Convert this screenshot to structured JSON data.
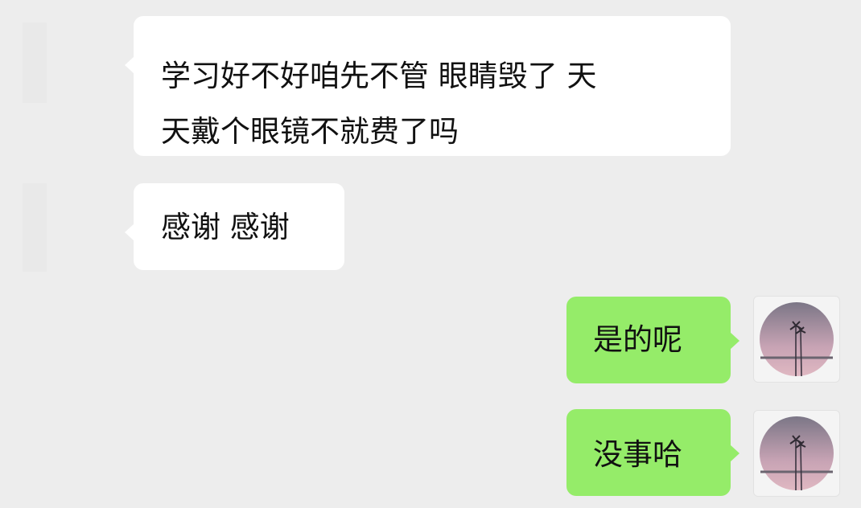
{
  "messages": [
    {
      "side": "incoming",
      "lines": [
        "学习好不好咱先不管  眼睛毁了 天",
        "天戴个眼镜不就费了吗"
      ]
    },
    {
      "side": "incoming",
      "lines": [
        "感谢 感谢"
      ]
    },
    {
      "side": "outgoing",
      "text": "是的呢",
      "avatar_icon": "palm-tree-sunset-avatar-icon"
    },
    {
      "side": "outgoing",
      "text": "没事哈",
      "avatar_icon": "palm-tree-sunset-avatar-icon"
    }
  ],
  "colors": {
    "background": "#ededed",
    "incoming_bubble": "#ffffff",
    "outgoing_bubble": "#95ec69",
    "text": "#111111"
  }
}
